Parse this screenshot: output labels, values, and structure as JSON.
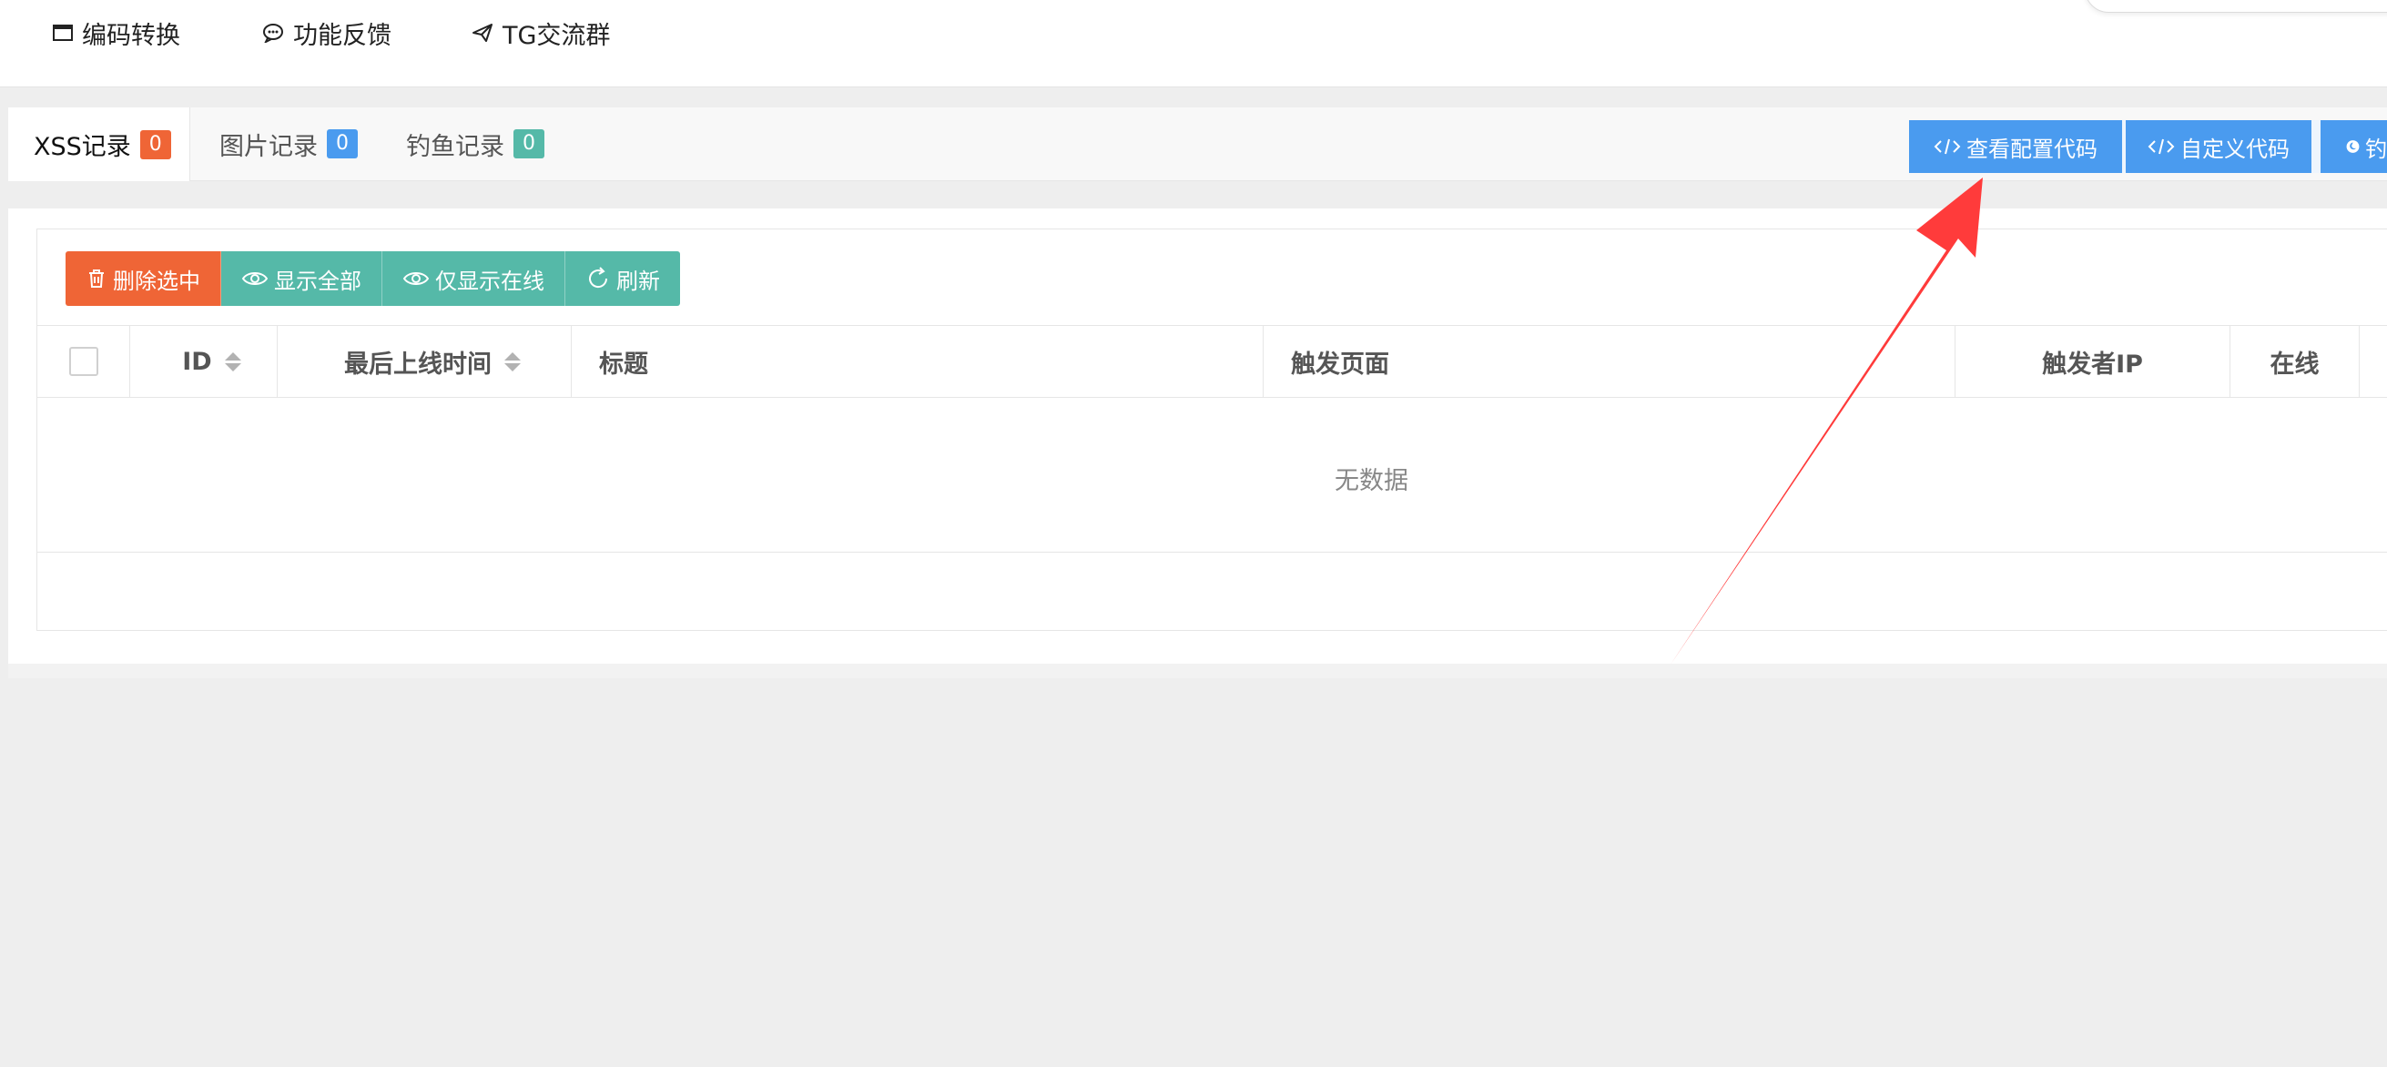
{
  "topnav": {
    "items": [
      {
        "label": "编码转换",
        "icon": "window-icon"
      },
      {
        "label": "功能反馈",
        "icon": "chat-bubble-icon"
      },
      {
        "label": "TG交流群",
        "icon": "paper-plane-icon"
      }
    ]
  },
  "tabs": [
    {
      "label": "XSS记录",
      "count": "0",
      "color": "#ef6536"
    },
    {
      "label": "图片记录",
      "count": "0",
      "color": "#4a9bef"
    },
    {
      "label": "钓鱼记录",
      "count": "0",
      "color": "#55b9a8"
    }
  ],
  "toolbar": {
    "view_config_code": "查看配置代码",
    "custom_code": "自定义代码",
    "third_partial": "钓",
    "accent": "#4a9bef"
  },
  "actions": {
    "delete_selected": "删除选中",
    "show_all": "显示全部",
    "show_online_only": "仅显示在线",
    "refresh": "刷新"
  },
  "table": {
    "columns": [
      "ID",
      "最后上线时间",
      "标题",
      "触发页面",
      "触发者IP",
      "在线"
    ],
    "empty_text": "无数据"
  },
  "annotation": {
    "arrow_color": "#ff3b3b",
    "icon": "red-arrow-annotation"
  }
}
